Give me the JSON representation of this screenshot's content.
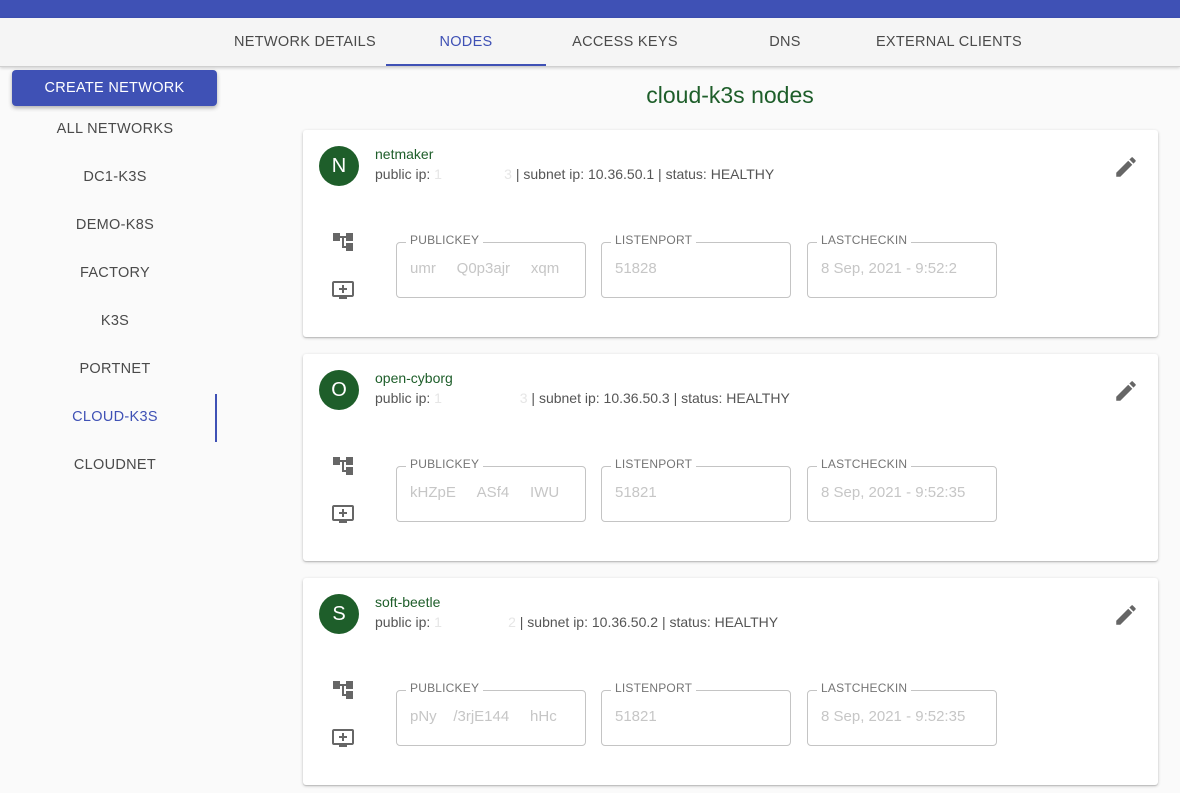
{
  "tabs": [
    {
      "label": "NETWORK DETAILS"
    },
    {
      "label": "NODES"
    },
    {
      "label": "ACCESS KEYS"
    },
    {
      "label": "DNS"
    },
    {
      "label": "EXTERNAL CLIENTS"
    }
  ],
  "active_tab": "NODES",
  "sidebar": {
    "create_label": "CREATE NETWORK",
    "items": [
      {
        "label": "ALL NETWORKS"
      },
      {
        "label": "DC1-K3S"
      },
      {
        "label": "DEMO-K8S"
      },
      {
        "label": "FACTORY"
      },
      {
        "label": "K3S"
      },
      {
        "label": "PORTNET"
      },
      {
        "label": "CLOUD-K3S"
      },
      {
        "label": "CLOUDNET"
      }
    ],
    "active_item": "CLOUD-K3S"
  },
  "page": {
    "title": "cloud-k3s nodes"
  },
  "field_labels": {
    "publickey": "PUBLICKEY",
    "listenport": "LISTENPORT",
    "lastcheckin": "LASTCHECKIN"
  },
  "nodes": [
    {
      "initial": "N",
      "name": "netmaker",
      "public_ip_label": "public ip:",
      "public_ip_masked": "1                3",
      "rest": "| subnet ip: 10.36.50.1 | status: HEALTHY",
      "publickey": "umr     Q0p3ajr     xqm",
      "listenport": "51828",
      "lastcheckin": "8 Sep, 2021 - 9:52:2"
    },
    {
      "initial": "O",
      "name": "open-cyborg",
      "public_ip_label": "public ip:",
      "public_ip_masked": "1                    3",
      "rest": "| subnet ip: 10.36.50.3 | status: HEALTHY",
      "publickey": "kHZpE     ASf4     IWU",
      "listenport": "51821",
      "lastcheckin": "8 Sep, 2021 - 9:52:35"
    },
    {
      "initial": "S",
      "name": "soft-beetle",
      "public_ip_label": "public ip:",
      "public_ip_masked": "1                 2",
      "rest": "| subnet ip: 10.36.50.2 | status: HEALTHY",
      "publickey": "pNy    /3rjE144     hHc",
      "listenport": "51821",
      "lastcheckin": "8 Sep, 2021 - 9:52:35"
    }
  ],
  "colors": {
    "primary": "#3f51b5",
    "node_green": "#1e5e2a"
  },
  "icons": {
    "edit": "pencil-icon",
    "tree": "account-tree-icon",
    "add_screen": "add-to-queue-icon"
  }
}
